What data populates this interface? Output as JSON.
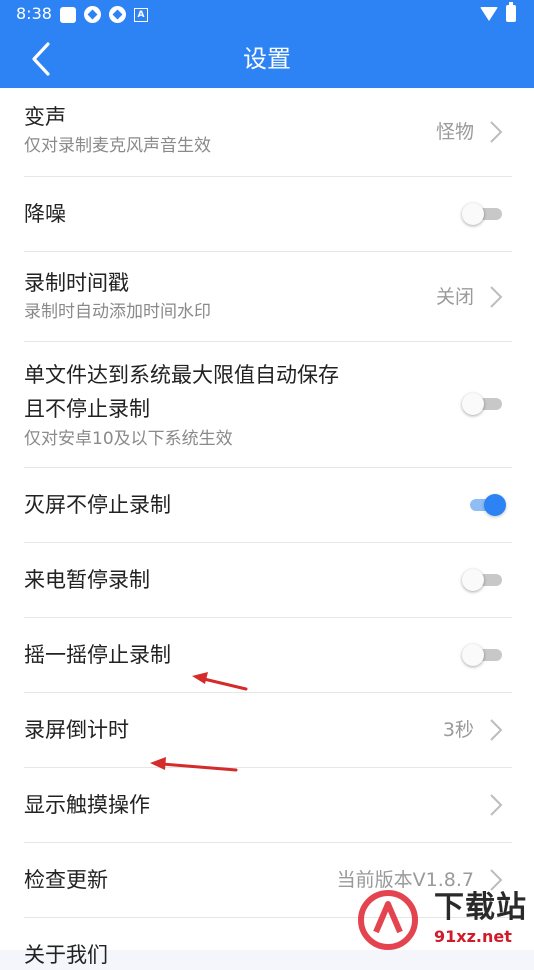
{
  "status_bar": {
    "time": "8:38"
  },
  "toolbar": {
    "title": "设置"
  },
  "settings": {
    "voice_change": {
      "title": "变声",
      "subtitle": "仅对录制麦克风声音生效",
      "value": "怪物"
    },
    "noise_reduction": {
      "title": "降噪",
      "enabled": false
    },
    "timestamp": {
      "title": "录制时间戳",
      "subtitle": "录制时自动添加时间水印",
      "value": "关闭"
    },
    "auto_save": {
      "title_line1": "单文件达到系统最大限值自动保存",
      "title_line2": "且不停止录制",
      "subtitle": "仅对安卓10及以下系统生效",
      "enabled": false
    },
    "screen_off": {
      "title": "灭屏不停止录制",
      "enabled": true
    },
    "call_pause": {
      "title": "来电暂停录制",
      "enabled": false
    },
    "shake_stop": {
      "title": "摇一摇停止录制",
      "enabled": false
    },
    "countdown": {
      "title": "录屏倒计时",
      "value": "3秒"
    },
    "show_touch": {
      "title": "显示触摸操作"
    },
    "check_update": {
      "title": "检查更新",
      "value": "当前版本V1.8.7"
    },
    "about": {
      "title": "关于我们"
    }
  },
  "watermark": {
    "text": "下载站",
    "url": "91xz.net"
  },
  "colors": {
    "accent": "#2d83f3",
    "annotation_arrow": "#d42b2b"
  }
}
